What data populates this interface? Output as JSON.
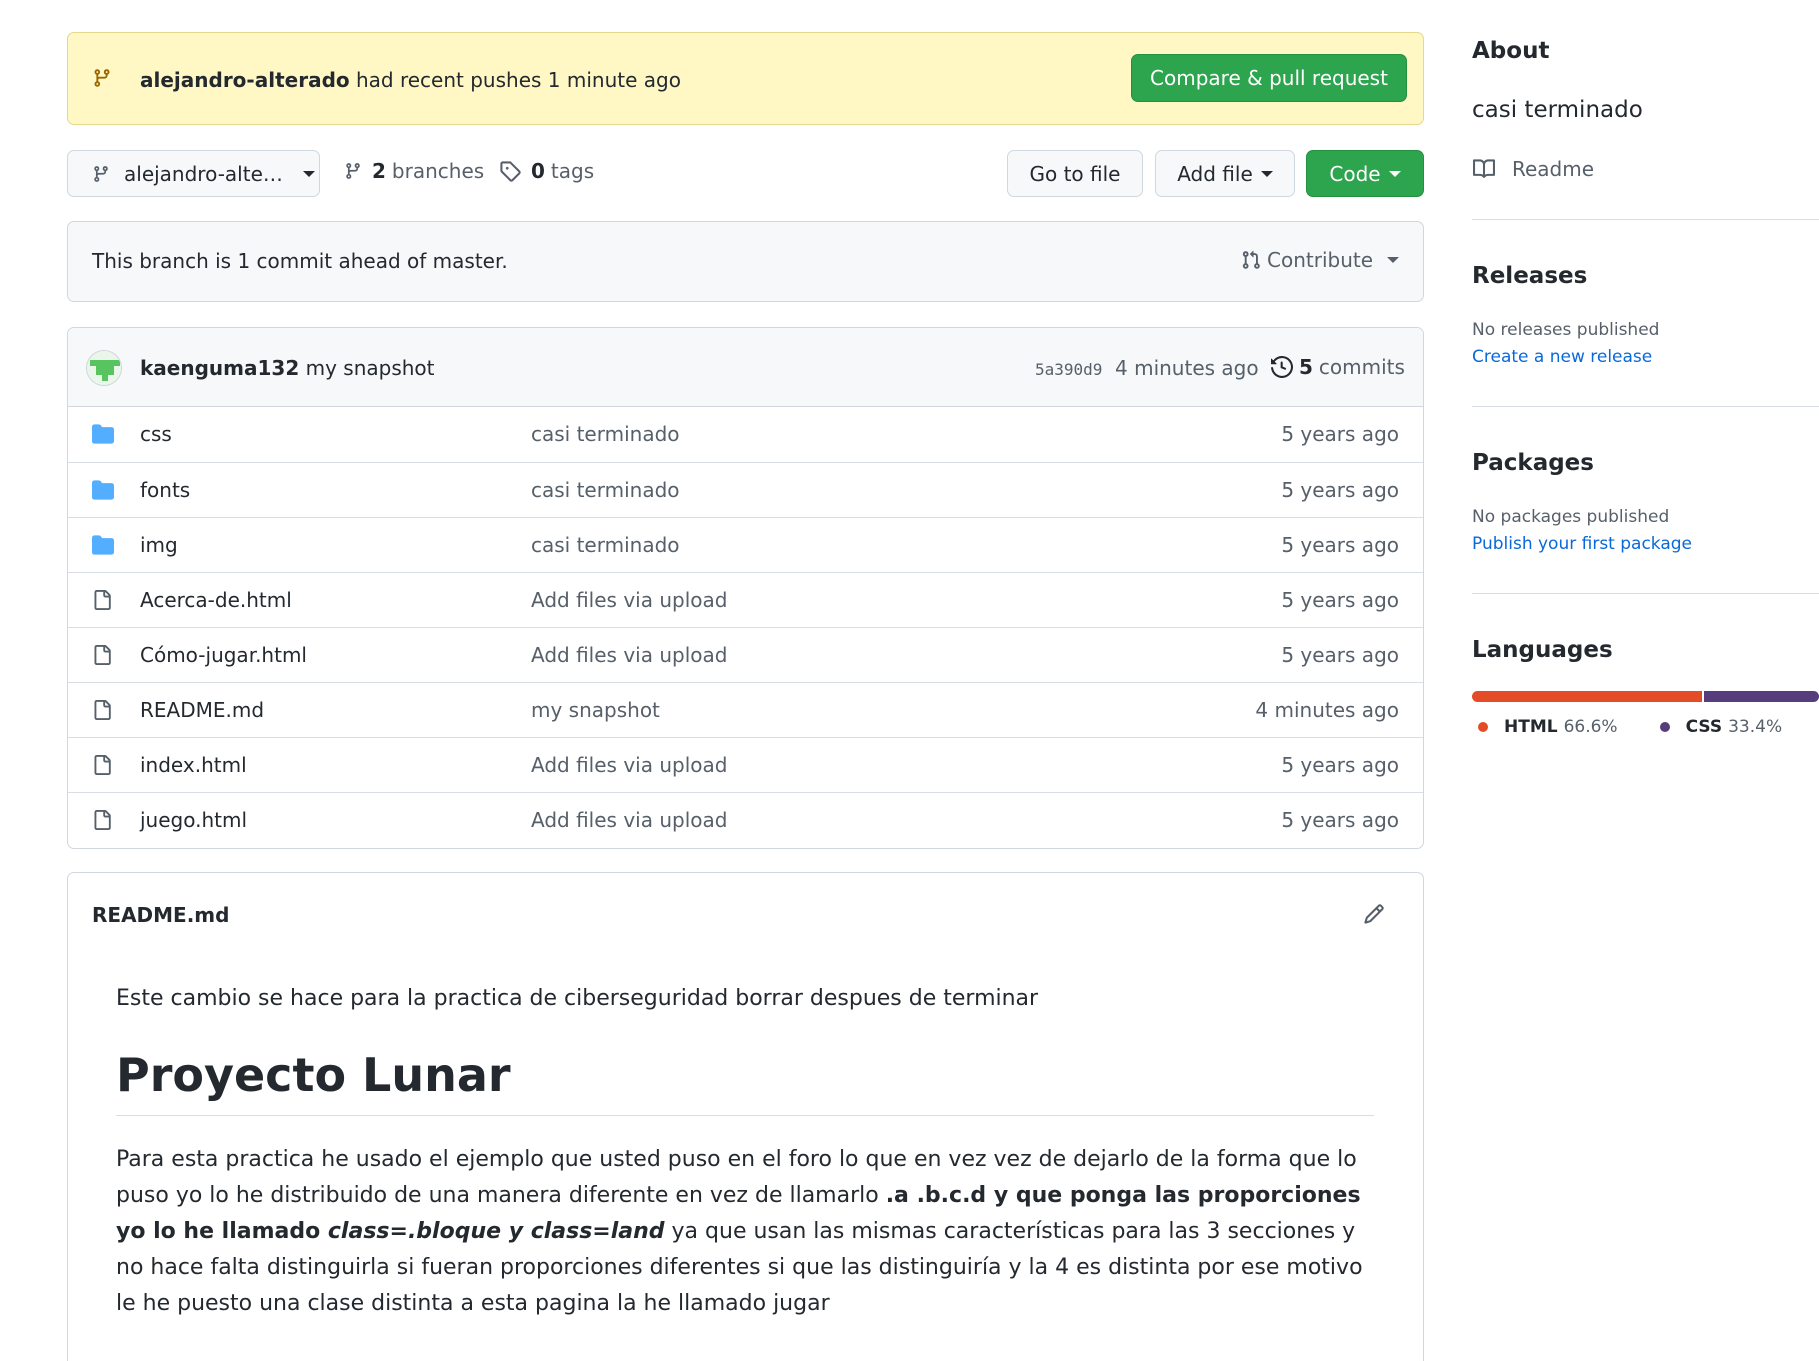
{
  "push_banner": {
    "branch": "alejandro-alterado",
    "message": "had recent pushes 1 minute ago",
    "compare_button": "Compare & pull request"
  },
  "repo_nav": {
    "branch_select": "alejandro-alte…",
    "branches_count": "2",
    "branches_label": "branches",
    "tags_count": "0",
    "tags_label": "tags",
    "goto_file": "Go to file",
    "add_file": "Add file",
    "code": "Code"
  },
  "branch_status": {
    "text": "This branch is 1 commit ahead of master.",
    "contribute": "Contribute"
  },
  "latest_commit": {
    "author": "kaenguma132",
    "message": "my snapshot",
    "sha": "5a390d9",
    "time": "4 minutes ago",
    "commits_count": "5",
    "commits_label": "commits"
  },
  "files": [
    {
      "name": "css",
      "type": "folder",
      "message": "casi terminado",
      "age": "5 years ago"
    },
    {
      "name": "fonts",
      "type": "folder",
      "message": "casi terminado",
      "age": "5 years ago"
    },
    {
      "name": "img",
      "type": "folder",
      "message": "casi terminado",
      "age": "5 years ago"
    },
    {
      "name": "Acerca-de.html",
      "type": "file",
      "message": "Add files via upload",
      "age": "5 years ago"
    },
    {
      "name": "Cómo-jugar.html",
      "type": "file",
      "message": "Add files via upload",
      "age": "5 years ago"
    },
    {
      "name": "README.md",
      "type": "file",
      "message": "my snapshot",
      "age": "4 minutes ago"
    },
    {
      "name": "index.html",
      "type": "file",
      "message": "Add files via upload",
      "age": "5 years ago"
    },
    {
      "name": "juego.html",
      "type": "file",
      "message": "Add files via upload",
      "age": "5 years ago"
    }
  ],
  "readme": {
    "title": "README.md",
    "intro": "Este cambio se hace para la practica de ciberseguridad borrar despues de terminar",
    "heading": "Proyecto Lunar",
    "para_part1": "Para esta practica he usado el ejemplo que usted puso en el foro lo que en vez vez de dejarlo de la forma que lo puso yo lo he distribuido de una manera diferente en vez de llamarlo ",
    "para_bold1": ".a .b.c.d y que ponga las proporciones yo lo he llamado ",
    "para_bold_italic": "class=.bloque y class=land",
    "para_part2": " ya que usan las mismas características para las 3 secciones y no hace falta distinguirla si fueran proporciones diferentes si que las distinguiría y la 4 es distinta por ese motivo le he puesto una clase distinta a esta pagina la he llamado jugar"
  },
  "sidebar": {
    "about_heading": "About",
    "about_description": "casi terminado",
    "readme_link": "Readme",
    "releases_heading": "Releases",
    "releases_empty": "No releases published",
    "releases_link": "Create a new release",
    "packages_heading": "Packages",
    "packages_empty": "No packages published",
    "packages_link": "Publish your first package",
    "languages_heading": "Languages",
    "languages": [
      {
        "name": "HTML",
        "percent": "66.6%",
        "value": 66.6,
        "color": "#e34c26"
      },
      {
        "name": "CSS",
        "percent": "33.4%",
        "value": 33.4,
        "color": "#563d7c"
      }
    ]
  },
  "icons": {
    "branch": "git-branch-icon",
    "tag": "tag-icon",
    "folder": "folder-icon",
    "file": "file-icon",
    "history": "history-icon",
    "pull_request": "git-pull-request-icon",
    "book": "book-icon",
    "pencil": "pencil-icon"
  },
  "colors": {
    "banner_bg": "#fff8c5",
    "green": "#2da44e",
    "folder": "#54aeff",
    "link": "#0969da"
  }
}
